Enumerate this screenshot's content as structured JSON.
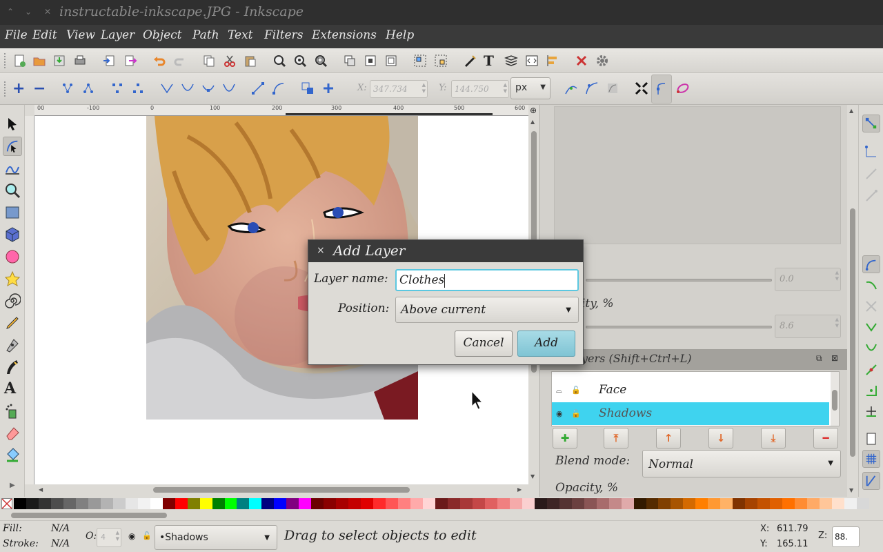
{
  "window": {
    "title": "instructable-inkscape.JPG - Inkscape"
  },
  "menu": [
    "File",
    "Edit",
    "View",
    "Layer",
    "Object",
    "Path",
    "Text",
    "Filters",
    "Extensions",
    "Help"
  ],
  "node_toolbar": {
    "x_label": "X:",
    "x_value": "347.734",
    "y_label": "Y:",
    "y_value": "144.750",
    "unit": "px"
  },
  "ruler": {
    "labels": [
      "00",
      "-100",
      "0",
      "100",
      "200",
      "300",
      "400",
      "500",
      "600"
    ]
  },
  "dock": {
    "top_field_1": "0.0",
    "partial_label": "ity, %",
    "top_field_2": "8.6",
    "layers_title": "yers (Shift+Ctrl+L)",
    "layers": [
      {
        "name": "Face",
        "selected": false
      },
      {
        "name": "Shadows",
        "selected": true
      }
    ],
    "blend_label": "Blend mode:",
    "blend_value": "Normal",
    "opacity_label": "Opacity, %"
  },
  "dialog": {
    "title": "Add Layer",
    "close": "×",
    "layer_name_label": "Layer name:",
    "layer_name_value": "Clothes",
    "position_label": "Position:",
    "position_value": "Above current",
    "cancel_label": "Cancel",
    "add_label": "Add"
  },
  "status": {
    "fill_label": "Fill:",
    "fill_value": "N/A",
    "stroke_label": "Stroke:",
    "stroke_value": "N/A",
    "opacity_label": "O:",
    "opacity_value": "4",
    "current_layer": "•Shadows",
    "message": "Drag to select objects to edit",
    "x_label": "X:",
    "x_value": "611.79",
    "y_label": "Y:",
    "y_value": "165.11",
    "zoom_label": "Z:",
    "zoom_value": "88."
  },
  "palette": [
    "#000000",
    "#1a1a1a",
    "#333333",
    "#4d4d4d",
    "#666666",
    "#808080",
    "#999999",
    "#b3b3b3",
    "#cccccc",
    "#e6e6e6",
    "#f2f2f2",
    "#ffffff",
    "#800000",
    "#ff0000",
    "#808000",
    "#ffff00",
    "#008000",
    "#00ff00",
    "#008080",
    "#00ffff",
    "#000080",
    "#0000ff",
    "#800080",
    "#ff00ff",
    "#6b0000",
    "#8a0000",
    "#a80000",
    "#c40000",
    "#e00000",
    "#ff2a2a",
    "#ff5555",
    "#ff8080",
    "#ffaaaa",
    "#ffd5d5",
    "#6b1a1a",
    "#8a2a2a",
    "#a83838",
    "#c44747",
    "#e06060",
    "#f08080",
    "#f5aaaa",
    "#fad0d0",
    "#2a1a1a",
    "#3d2525",
    "#553333",
    "#6b4040",
    "#8a5555",
    "#a86c6c",
    "#c48989",
    "#e0aaaa",
    "#331a00",
    "#552b00",
    "#803f00",
    "#a85400",
    "#d46a00",
    "#ff7f00",
    "#ff9933",
    "#ffb266",
    "#803300",
    "#a64300",
    "#c45200",
    "#e06000",
    "#ff7000",
    "#ff8c33",
    "#ffaa66",
    "#ffc699",
    "#ffe0cc",
    "#f0f0f0",
    "#d8d8d8"
  ]
}
